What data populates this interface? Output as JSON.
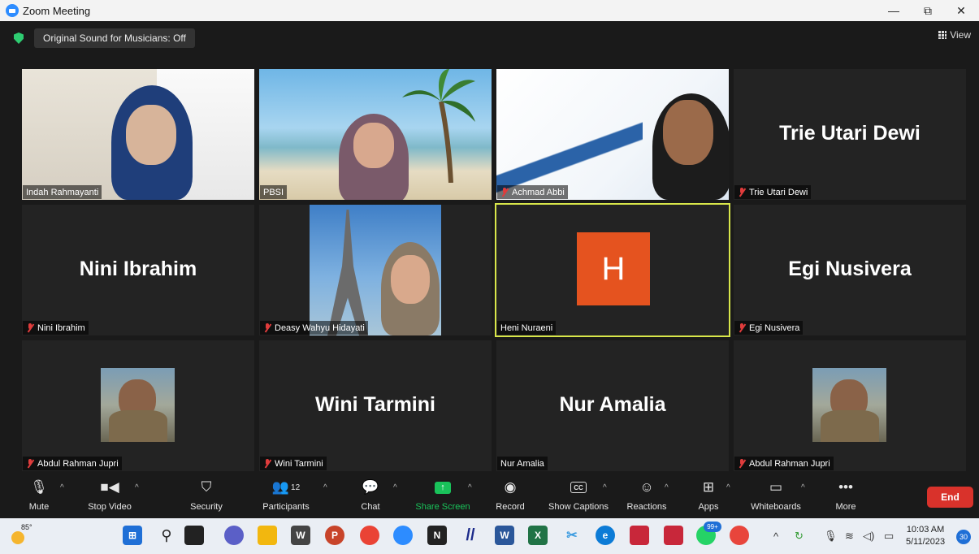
{
  "window": {
    "title": "Zoom Meeting",
    "controls": [
      "—",
      "⧉",
      "✕"
    ]
  },
  "meeting": {
    "sound_button": "Original Sound for Musicians: Off",
    "view_label": "View"
  },
  "participants": [
    {
      "name": "Indah Rahmayanti",
      "display": "",
      "video": true,
      "muted": false
    },
    {
      "name": "PBSI",
      "display": "",
      "video": true,
      "muted": false
    },
    {
      "name": "Achmad Abbi",
      "display": "",
      "video": true,
      "muted": true
    },
    {
      "name": "Trie Utari Dewi",
      "display": "Trie Utari Dewi",
      "video": false,
      "muted": true
    },
    {
      "name": "Nini Ibrahim",
      "display": "Nini Ibrahim",
      "video": false,
      "muted": true
    },
    {
      "name": "Deasy Wahyu Hidayati",
      "display": "",
      "video": false,
      "muted": true
    },
    {
      "name": "Heni Nuraeni",
      "display": "H",
      "video": false,
      "muted": false,
      "active_speaker": true
    },
    {
      "name": "Egi Nusivera",
      "display": "Egi Nusivera",
      "video": false,
      "muted": true
    },
    {
      "name": "Abdul Rahman Jupri",
      "display": "",
      "video": false,
      "muted": true
    },
    {
      "name": "Wini Tarmini",
      "display": "Wini Tarmini",
      "video": false,
      "muted": true
    },
    {
      "name": "Nur Amalia",
      "display": "Nur Amalia",
      "video": false,
      "muted": false
    },
    {
      "name": "Abdul Rahman Jupri",
      "display": "",
      "video": false,
      "muted": true
    }
  ],
  "toolbar": {
    "mute": "Mute",
    "stop_video": "Stop Video",
    "security": "Security",
    "participants": "Participants",
    "participants_count": "12",
    "chat": "Chat",
    "share_screen": "Share Screen",
    "record": "Record",
    "show_captions": "Show Captions",
    "cc": "CC",
    "reactions": "Reactions",
    "apps": "Apps",
    "whiteboards": "Whiteboards",
    "more": "More",
    "end": "End"
  },
  "taskbar": {
    "weather_temp": "85°",
    "chat_badge": "99+",
    "time": "10:03 AM",
    "date": "5/11/2023",
    "notifications": "30",
    "accent": "#1f6fd6"
  },
  "colors": {
    "active_speaker_border": "#d8e64a",
    "end_button": "#d9322b",
    "share_green": "#19c25a",
    "avatar_h": "#e5531f"
  }
}
